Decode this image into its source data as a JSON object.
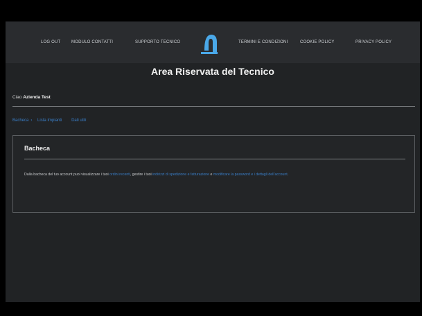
{
  "nav": {
    "left_links": [
      "LOG OUT",
      "MODULO CONTATTI",
      "SUPPORTO TECNICO"
    ],
    "right_links": [
      "TERMINI E CONDIZIONI",
      "COOKIE POLICY",
      "PRIVACY POLICY"
    ],
    "logo_icon": "site-logo-icon"
  },
  "header": {
    "title": "Area Riservata del Tecnico"
  },
  "greeting": {
    "prefix": "Ciao",
    "name": "Azienda Test"
  },
  "tabs": [
    {
      "label": "Bacheca"
    },
    {
      "label": "Lista Impianti"
    },
    {
      "label": "Dati utili"
    }
  ],
  "dashboard": {
    "title": "Bacheca",
    "text_1": "Dalla bacheca del tuo account puoi visualizzare i tuoi ",
    "link_1": "ordini recenti",
    "text_2": ", gestire i tuoi ",
    "link_2": "indirizzi di spedizione e fatturazione",
    "text_3": " e ",
    "link_3": "modificare la password e i dettagli dell'account",
    "text_4": "."
  },
  "colors": {
    "background": "#212325",
    "nav_background": "#2a2c2f",
    "link": "#3a7fc9",
    "logo": "#4aa8e8"
  }
}
